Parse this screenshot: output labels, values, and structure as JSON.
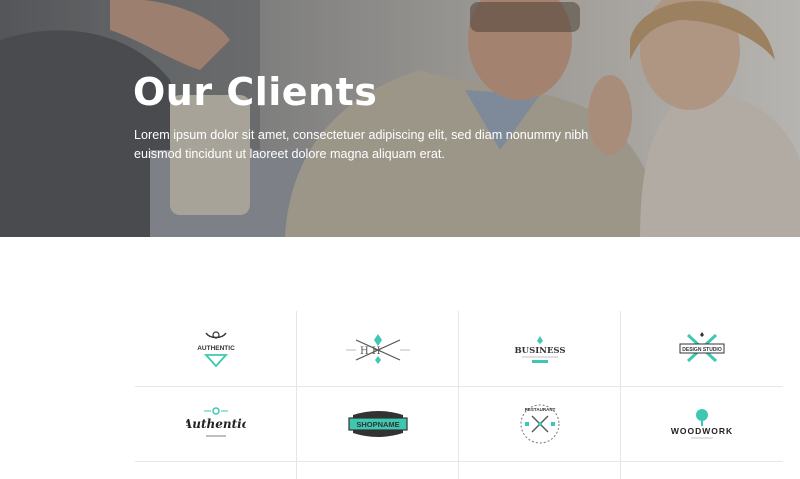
{
  "hero": {
    "title": "Our Clients",
    "description": "Lorem ipsum dolor sit amet, consectetuer adipiscing elit, sed diam nonummy nibh euismod tincidunt ut laoreet dolore magna aliquam erat."
  },
  "colors": {
    "accent": "#3ec8b1",
    "logo_dark": "#333333",
    "grid_line": "#e6e6e6"
  },
  "logos": [
    {
      "name": "authentic-badge-logo",
      "text": "AUTHENTIC"
    },
    {
      "name": "hh-arrows-logo",
      "text": "H H"
    },
    {
      "name": "business-logo",
      "text": "BUSINESS"
    },
    {
      "name": "design-studio-logo",
      "text": "DESIGN STUDIO"
    },
    {
      "name": "authentic-script-logo",
      "text": "Authentic"
    },
    {
      "name": "shopname-logo",
      "text": "SHOPNAME"
    },
    {
      "name": "restaurant-logo",
      "text": "RESTAURANT"
    },
    {
      "name": "woodwork-logo",
      "text": "WOODWORK"
    }
  ]
}
